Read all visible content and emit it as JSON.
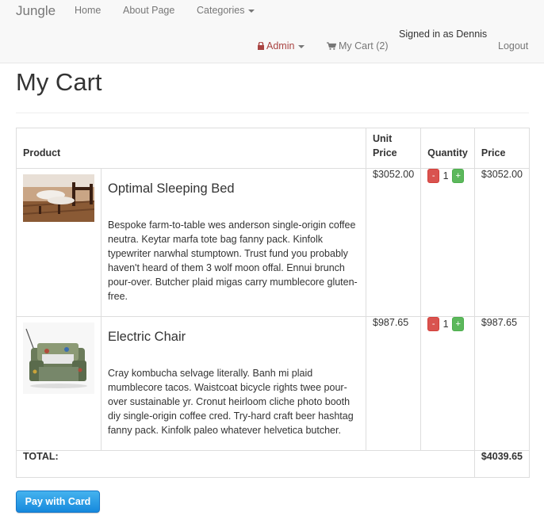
{
  "nav": {
    "brand": "Jungle",
    "home": "Home",
    "about": "About Page",
    "categories": "Categories",
    "admin": "Admin",
    "cart": "My Cart (2)",
    "signed_in": "Signed in as Dennis",
    "logout": "Logout"
  },
  "page": {
    "title": "My Cart"
  },
  "table": {
    "headers": {
      "product": "Product",
      "unit_price": "Unit Price",
      "quantity": "Quantity",
      "price": "Price"
    },
    "rows": [
      {
        "name": "Optimal Sleeping Bed",
        "description": "Bespoke farm-to-table wes anderson single-origin coffee neutra. Keytar marfa tote bag fanny pack. Kinfolk typewriter narwhal stumptown. Trust fund you probably haven't heard of them 3 wolf moon offal. Ennui brunch pour-over. Butcher plaid migas carry mumblecore gluten-free.",
        "unit_price": "$3052.00",
        "minus": "-",
        "quantity": "1",
        "plus": "+",
        "price": "$3052.00"
      },
      {
        "name": "Electric Chair",
        "description": "Cray kombucha selvage literally. Banh mi plaid mumblecore tacos. Waistcoat bicycle rights twee pour-over sustainable yr. Cronut heirloom cliche photo booth diy single-origin coffee cred. Try-hard craft beer hashtag fanny pack. Kinfolk paleo whatever helvetica butcher.",
        "unit_price": "$987.65",
        "minus": "-",
        "quantity": "1",
        "plus": "+",
        "price": "$987.65"
      }
    ],
    "total_label": "TOTAL:",
    "total_value": "$4039.65"
  },
  "pay_button": "Pay with Card",
  "colors": {
    "admin": "#a94442",
    "minus": "#d9534f",
    "plus": "#5cb85c",
    "pay": "#1689dd"
  },
  "icons": {
    "admin": "lock-icon",
    "cart": "shopping-cart-icon"
  }
}
